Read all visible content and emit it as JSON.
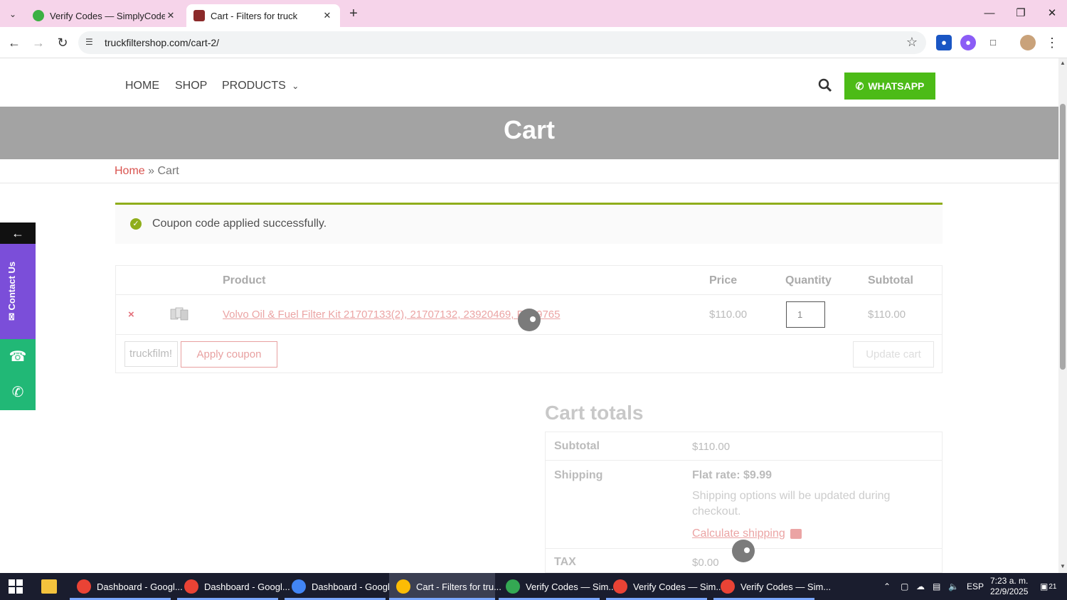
{
  "browser": {
    "tabs": [
      {
        "title": "Verify Codes — SimplyCodes",
        "active": false
      },
      {
        "title": "Cart - Filters for truck",
        "active": true
      }
    ],
    "url": "truckfiltershop.com/cart-2/"
  },
  "site": {
    "nav": [
      "HOME",
      "SHOP",
      "PRODUCTS"
    ],
    "whatsapp_label": "WHATSAPP",
    "page_title": "Cart",
    "breadcrumb": {
      "home": "Home",
      "separator": "»",
      "current": "Cart"
    },
    "notice": "Coupon code applied successfully.",
    "cart": {
      "headers": {
        "product": "Product",
        "price": "Price",
        "quantity": "Quantity",
        "subtotal": "Subtotal"
      },
      "item": {
        "remove": "×",
        "name": "Volvo Oil & Fuel Filter Kit 21707133(2), 21707132, 23920469, FS19765",
        "price": "$110.00",
        "quantity": "1",
        "subtotal": "$110.00"
      },
      "coupon_value": "truckfilm!",
      "apply_coupon": "Apply coupon",
      "update_cart": "Update cart"
    },
    "totals": {
      "title": "Cart totals",
      "subtotal_label": "Subtotal",
      "subtotal_value": "$110.00",
      "shipping_label": "Shipping",
      "shipping_value": "Flat rate: $9.99",
      "shipping_note": "Shipping options will be updated during checkout.",
      "calculate_shipping": "Calculate shipping",
      "tax_label": "TAX",
      "tax_value": "$0.00"
    },
    "sidebar": {
      "contact_label": "Contact Us",
      "arrow": "←"
    }
  },
  "taskbar": {
    "items": [
      {
        "label": "Dashboard - Googl...",
        "color": "#ea4335"
      },
      {
        "label": "Dashboard - Googl...",
        "color": "#ea4335"
      },
      {
        "label": "Dashboard - Googl...",
        "color": "#4285f4"
      },
      {
        "label": "Cart - Filters for tru...",
        "color": "#fbbc05"
      },
      {
        "label": "Verify Codes — Sim...",
        "color": "#34a853"
      },
      {
        "label": "Verify Codes — Sim...",
        "color": "#ea4335"
      },
      {
        "label": "Verify Codes — Sim...",
        "color": "#ea4335"
      }
    ],
    "lang": "ESP",
    "time": "7:23 a. m.",
    "date": "22/9/2025",
    "notifications": "21"
  },
  "colors": {
    "accent_green": "#4cbb17",
    "notice_green": "#8fae1b",
    "link_red": "#d9534f",
    "contact_purple": "#7b4ed9",
    "whatsapp_green": "#21b876"
  }
}
